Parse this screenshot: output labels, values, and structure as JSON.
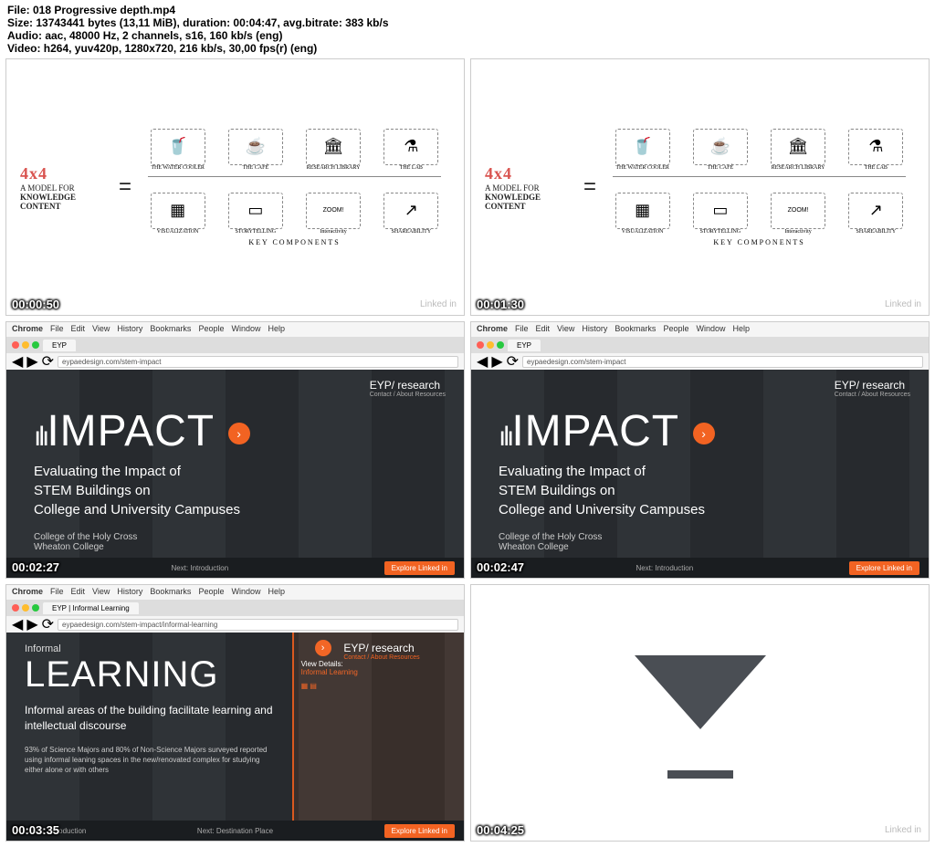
{
  "header": {
    "line1": "File: 018 Progressive depth.mp4",
    "line2": "Size: 13743441 bytes (13,11 MiB), duration: 00:04:47, avg.bitrate: 383 kb/s",
    "line3": "Audio: aac, 48000 Hz, 2 channels, s16, 160 kb/s (eng)",
    "line4": "Video: h264, yuv420p, 1280x720, 216 kb/s, 30,00 fps(r) (eng)"
  },
  "sketch": {
    "fxf": "4x4",
    "model": "A MODEL FOR",
    "knowledge": "KNOWLEDGE",
    "content": "CONTENT",
    "top_icons": [
      "THE WATER COOLER",
      "THE CAFÉ",
      "RESEARCH LIBRARY",
      "THE LAB"
    ],
    "bottom_icons": [
      "VISUALIZATION",
      "STORYTELLING",
      "Interactivity",
      "SHAREABILITY"
    ],
    "zoom": "ZOOM!",
    "key": "KEY COMPONENTS"
  },
  "browser": {
    "menu": [
      "Chrome",
      "File",
      "Edit",
      "View",
      "History",
      "Bookmarks",
      "People",
      "Window",
      "Help"
    ],
    "tab_eyp": "EYP",
    "tab_learning": "EYP | Informal Learning",
    "url1": "eypaedesign.com/stem-impact",
    "url2": "eypaedesign.com/stem-impact/informal-learning",
    "eyp": "EYP/ research",
    "eyp_sub": "Contact / About  Resources"
  },
  "impact": {
    "title": "IMPACT",
    "sub": "Evaluating the Impact of\nSTEM Buildings on\nCollege and University Campuses",
    "college1": "College of the Holy Cross",
    "college2": "Wheaton College",
    "next": "Next: Introduction",
    "explore": "Explore Linked in"
  },
  "learning": {
    "informal": "Informal",
    "title": "LEARNING",
    "sub": "Informal areas of the building facilitate learning and intellectual discourse",
    "detail": "93% of Science Majors and 80% of Non-Science Majors surveyed reported using informal leaning spaces in the new/renovated complex for studying either alone or with others",
    "view": "View Details:",
    "view_sub": "Informal Learning",
    "prev": "Previous: Introduction",
    "next": "Next: Destination Place"
  },
  "timestamps": [
    "00:00:50",
    "00:01:30",
    "00:02:27",
    "00:02:47",
    "00:03:35",
    "00:04:25"
  ],
  "linkedin": "Linked in"
}
